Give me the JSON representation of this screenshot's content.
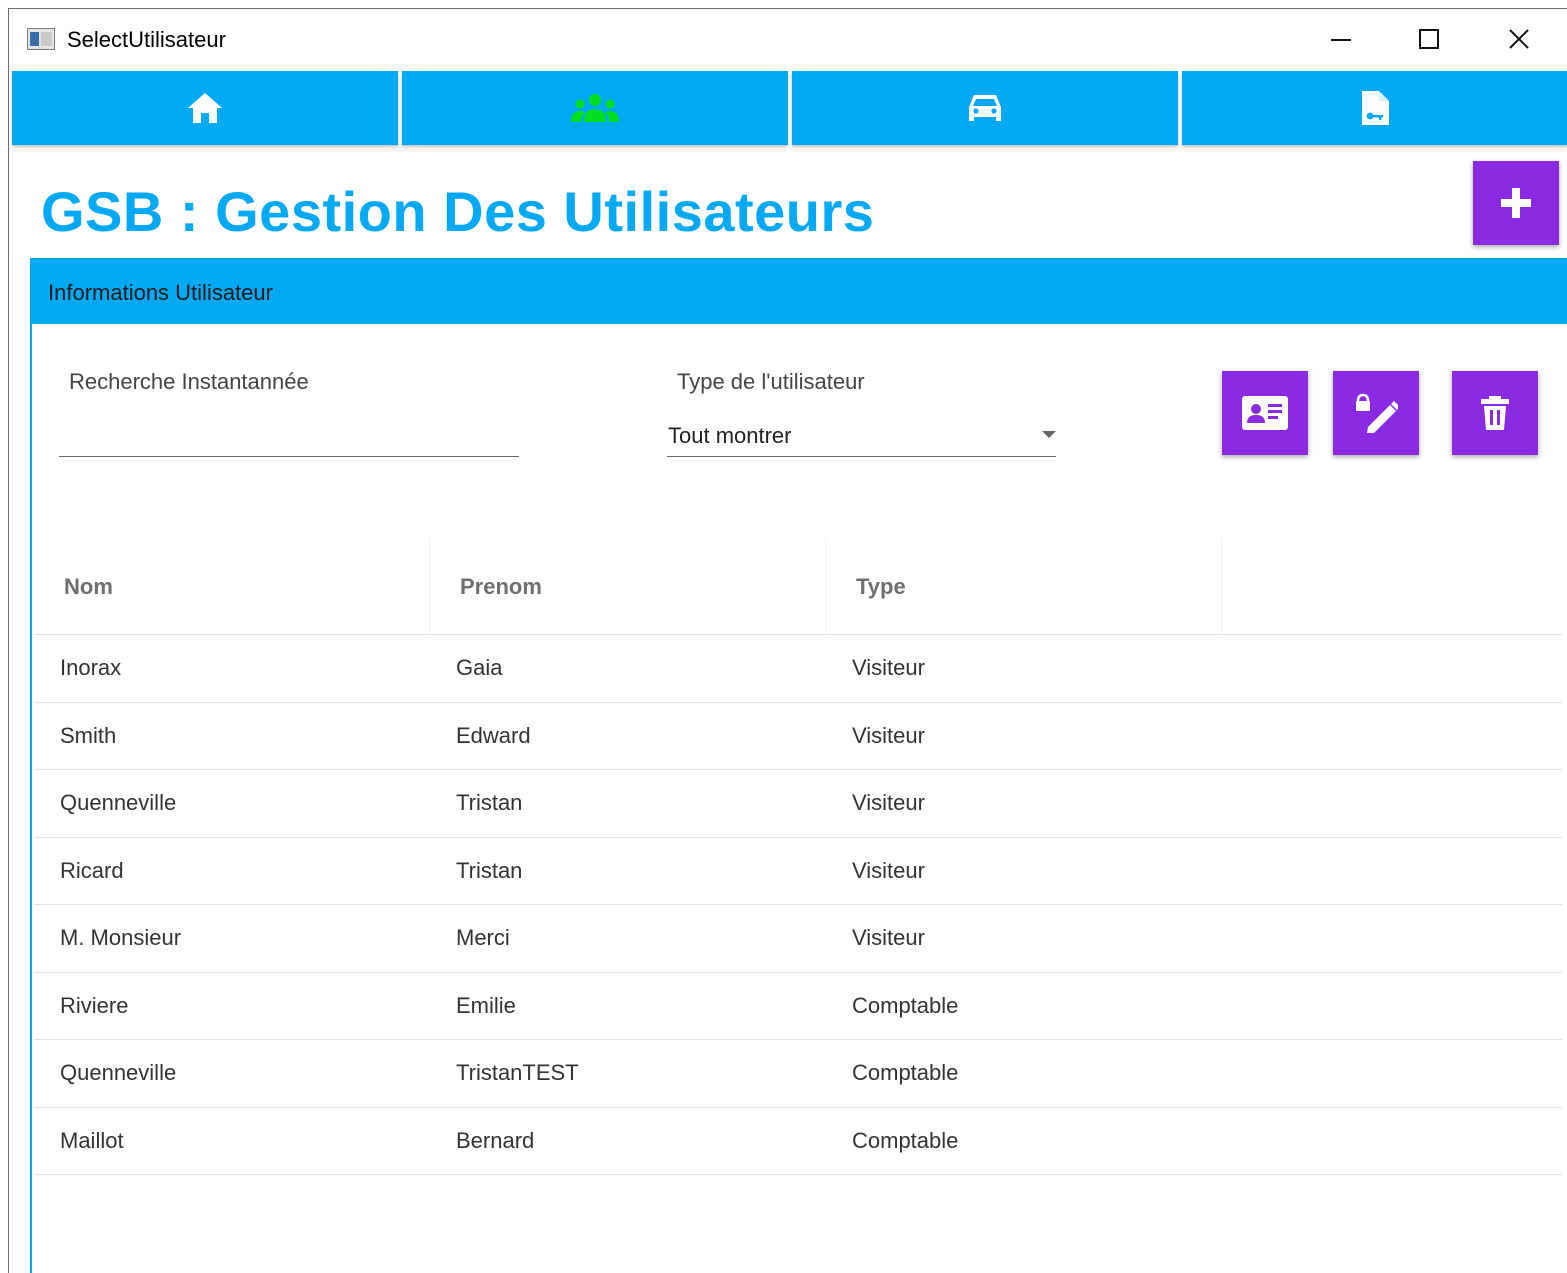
{
  "window": {
    "title": "SelectUtilisateur"
  },
  "nav": {
    "tabs": [
      {
        "icon": "home-icon"
      },
      {
        "icon": "users-icon",
        "active_color": "#00e020"
      },
      {
        "icon": "car-icon"
      },
      {
        "icon": "file-key-icon"
      }
    ]
  },
  "page": {
    "title": "GSB : Gestion Des Utilisateurs"
  },
  "card": {
    "header": "Informations Utilisateur",
    "search_label": "Recherche Instantannée",
    "search_value": "",
    "type_label": "Type de l'utilisateur",
    "type_value": "Tout montrer"
  },
  "table": {
    "columns": [
      "Nom",
      "Prenom",
      "Type"
    ],
    "rows": [
      {
        "nom": "Inorax",
        "prenom": "Gaia",
        "type": "Visiteur"
      },
      {
        "nom": "Smith",
        "prenom": "Edward",
        "type": "Visiteur"
      },
      {
        "nom": "Quenneville",
        "prenom": "Tristan",
        "type": "Visiteur"
      },
      {
        "nom": "Ricard",
        "prenom": "Tristan",
        "type": "Visiteur"
      },
      {
        "nom": "M. Monsieur",
        "prenom": "Merci",
        "type": "Visiteur"
      },
      {
        "nom": "Riviere",
        "prenom": "Emilie",
        "type": "Comptable"
      },
      {
        "nom": "Quenneville",
        "prenom": "TristanTEST",
        "type": "Comptable"
      },
      {
        "nom": "Maillot",
        "prenom": "Bernard",
        "type": "Comptable"
      }
    ]
  },
  "colors": {
    "accent": "#03a9f4",
    "button": "#8a2be2"
  }
}
